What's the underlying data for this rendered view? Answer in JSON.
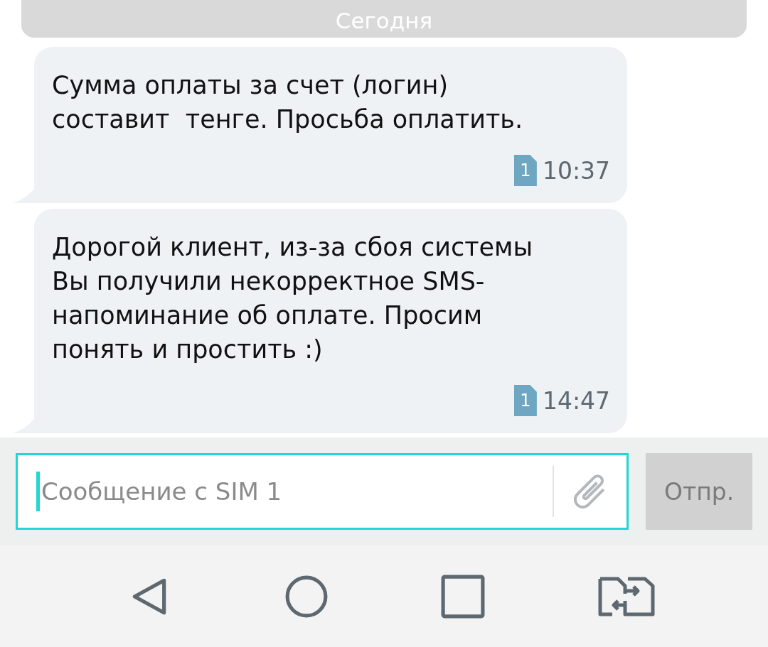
{
  "date_divider": "Сегодня",
  "messages": [
    {
      "text": "Сумма оплаты за счет (логин) составит  тенге. Просьба оплатить.",
      "sim": "1",
      "time": "10:37"
    },
    {
      "text": "Дорогой клиент, из-за сбоя системы Вы получили некорректное SMS-напоминание об оплате. Просим понять и простить :)",
      "sim": "1",
      "time": "14:47"
    }
  ],
  "composer": {
    "placeholder": "Сообщение с SIM 1",
    "send_label": "Отпр."
  }
}
